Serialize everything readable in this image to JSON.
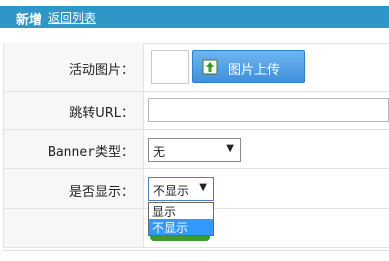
{
  "header": {
    "title": "新增",
    "back_link": "返回列表"
  },
  "form": {
    "image_label": "活动图片：",
    "upload_button": "图片上传",
    "url_label": "跳转URL：",
    "url_value": "",
    "type_label": "Banner类型：",
    "type_value": "无",
    "display_label": "是否显示：",
    "display_value": "不显示",
    "display_options": [
      "显示",
      "不显示"
    ],
    "display_selected_option": "不显示"
  },
  "colors": {
    "header_bg": "#2f97c8",
    "button_blue": "#4a9be3",
    "option_highlight": "#3399ff",
    "green_edge": "#3d9a2e"
  }
}
